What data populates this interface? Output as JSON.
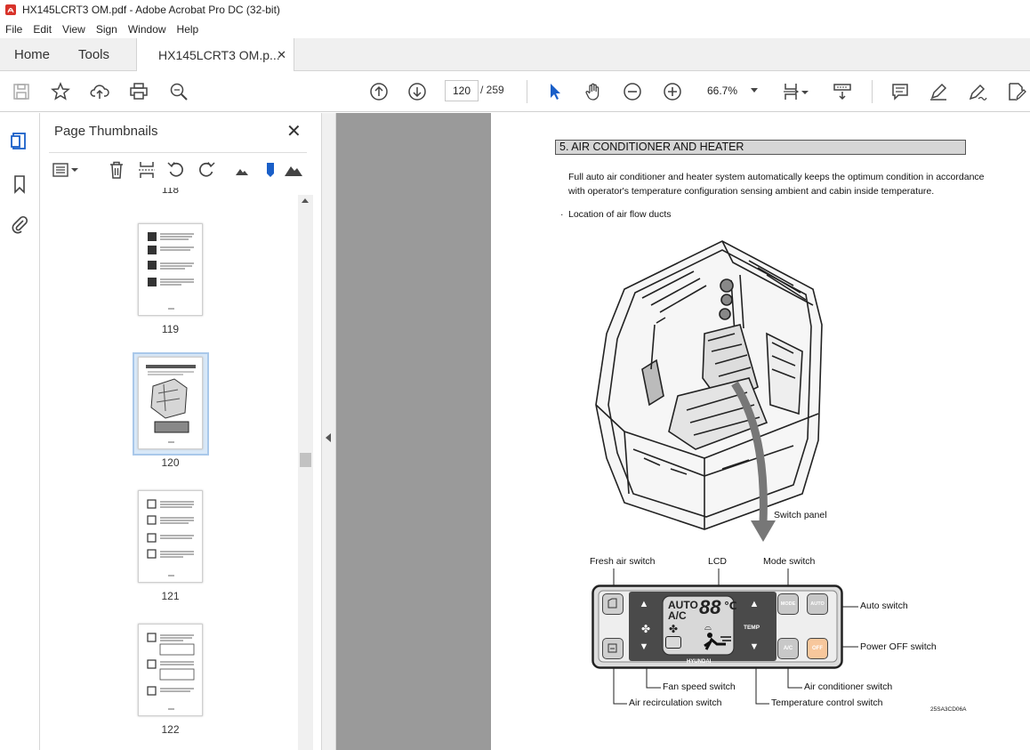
{
  "window": {
    "title": "HX145LCRT3 OM.pdf - Adobe Acrobat Pro DC (32-bit)"
  },
  "menu": [
    "File",
    "Edit",
    "View",
    "Sign",
    "Window",
    "Help"
  ],
  "tabs": {
    "home": "Home",
    "tools": "Tools",
    "document": "HX145LCRT3 OM.p..."
  },
  "toolbar": {
    "current_page": "120",
    "total_pages": "/ 259",
    "zoom": "66.7%"
  },
  "panel": {
    "title": "Page Thumbnails",
    "thumbnails": [
      {
        "label": "118"
      },
      {
        "label": "119"
      },
      {
        "label": "120"
      },
      {
        "label": "121"
      },
      {
        "label": "122"
      }
    ]
  },
  "doc": {
    "section_title": "5. AIR CONDITIONER AND HEATER",
    "intro_line1": "Full auto air conditioner and heater system automatically keeps the optimum condition in accordance",
    "intro_line2": "with operator's temperature configuration sensing ambient and cabin inside temperature.",
    "bullet": "·",
    "subheading": "Location of air flow ducts",
    "switch_panel_label": "Switch panel",
    "labels": {
      "fresh_air": "Fresh air switch",
      "lcd": "LCD",
      "mode": "Mode switch",
      "auto": "Auto switch",
      "power_off": "Power OFF switch",
      "fan_speed": "Fan speed switch",
      "air_conditioner": "Air conditioner switch",
      "air_recirc": "Air recirculation switch",
      "temp_control": "Temperature control switch"
    },
    "panel_text": {
      "auto": "AUTO",
      "ac": "A/C",
      "digits": "88",
      "unit": "℃",
      "mode_btn": "MODE",
      "auto_btn": "AUTO",
      "ac_btn": "A/C",
      "off_btn": "OFF",
      "temp": "TEMP",
      "brand": "HYUNDAI"
    },
    "figure_code": "25SA3CD06A"
  }
}
